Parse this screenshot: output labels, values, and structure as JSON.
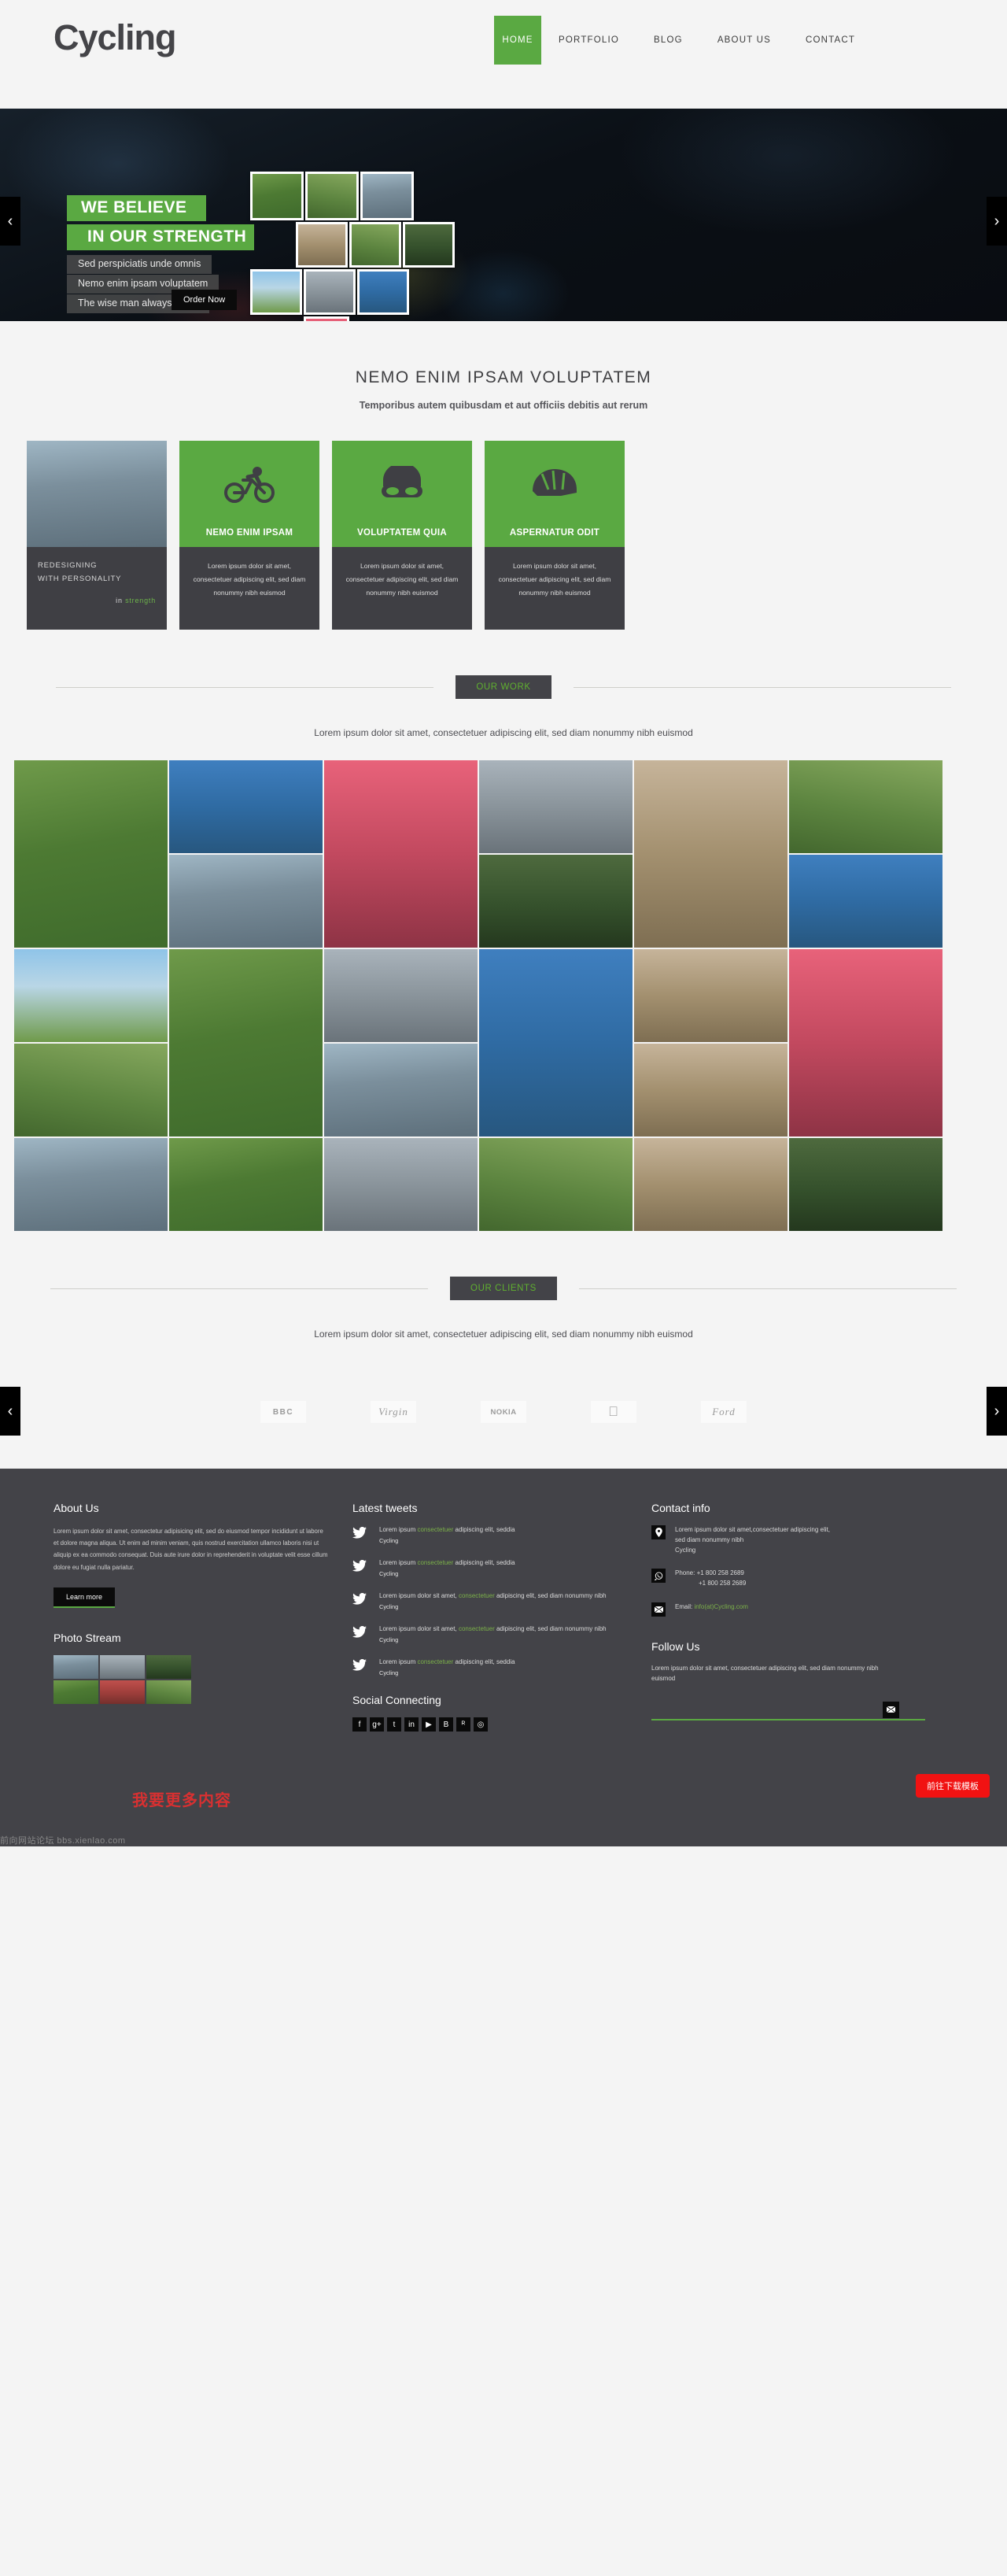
{
  "header": {
    "logo": "Cycling",
    "nav": [
      {
        "label": "HOME",
        "active": true
      },
      {
        "label": "PORTFOLIO",
        "active": false
      },
      {
        "label": "BLOG",
        "active": false
      },
      {
        "label": "ABOUT US",
        "active": false
      },
      {
        "label": "CONTACT",
        "active": false
      }
    ]
  },
  "hero": {
    "headline1": "WE BELIEVE",
    "headline2": "IN OUR STRENGTH",
    "sub1": "Sed perspiciatis unde omnis",
    "sub2": "Nemo enim ipsam voluptatem",
    "sub3": "The wise man always holds",
    "order_button": "Order Now",
    "prev_arrow": "‹",
    "next_arrow": "›",
    "dots": 5,
    "active_dot": 0,
    "accent_color": "#5aa942"
  },
  "intro": {
    "title": "NEMO ENIM IPSAM VOLUPTATEM",
    "subtitle": "Temporibus autem quibusdam et aut officiis debitis aut rerum"
  },
  "features": {
    "photo_card": {
      "line1": "REDESIGNING",
      "line2": "WITH PERSONALITY",
      "tail_plain": "in ",
      "tail_green": "strength"
    },
    "cards": [
      {
        "icon": "cyclist-icon",
        "title": "NEMO ENIM IPSAM",
        "body": "Lorem ipsum dolor sit amet, consectetuer adipiscing elit, sed diam nonummy nibh euismod"
      },
      {
        "icon": "goggles-icon",
        "title": "VOLUPTATEM QUIA",
        "body": "Lorem ipsum dolor sit amet, consectetuer adipiscing elit, sed diam nonummy nibh euismod"
      },
      {
        "icon": "helmet-icon",
        "title": "ASPERNATUR ODIT",
        "body": "Lorem ipsum dolor sit amet, consectetuer adipiscing elit, sed diam nonummy nibh euismod"
      }
    ]
  },
  "work": {
    "badge": "OUR WORK",
    "caption": "Lorem ipsum dolor sit amet, consectetuer adipiscing elit, sed diam nonummy nibh euismod"
  },
  "clients": {
    "badge": "OUR CLIENTS",
    "caption": "Lorem ipsum dolor sit amet, consectetuer adipiscing elit, sed diam nonummy nibh euismod",
    "prev_arrow": "‹",
    "next_arrow": "›",
    "logos": [
      {
        "name": "BBC",
        "label": "BBC"
      },
      {
        "name": "Virgin",
        "label": "Virgin"
      },
      {
        "name": "NOKIA",
        "label": "NOKIA"
      },
      {
        "name": "Apple",
        "label": ""
      },
      {
        "name": "Ford",
        "label": "Ford"
      }
    ]
  },
  "footer": {
    "about": {
      "title": "About Us",
      "text": "Lorem ipsum dolor sit amet, consectetur adipisicing elit, sed do eiusmod tempor incididunt ut labore et dolore magna aliqua. Ut enim ad minim veniam, quis nostrud exercitation ullamco laboris nisi ut aliquip ex ea commodo consequat. Duis aute irure dolor in reprehenderit in voluptate velit esse cillum dolore eu fugiat nulla pariatur.",
      "button": "Learn more"
    },
    "photo_stream": {
      "title": "Photo Stream"
    },
    "tweets": {
      "title": "Latest tweets",
      "items": [
        {
          "pre": "Lorem ipsum ",
          "link": "consectetuer",
          "post": " adipiscing elit, seddia",
          "handle": "Cycling"
        },
        {
          "pre": "Lorem ipsum ",
          "link": "consectetuer",
          "post": " adipiscing elit, seddia",
          "handle": "Cycling"
        },
        {
          "pre": "Lorem ipsum dolor sit amet, ",
          "link": "consectetuer",
          "post": " adipiscing elit, sed diam nonummy nibh",
          "handle": "Cycling"
        },
        {
          "pre": "Lorem ipsum dolor sit amet, ",
          "link": "consectetuer",
          "post": " adipiscing elit, sed diam nonummy nibh",
          "handle": "Cycling"
        },
        {
          "pre": "Lorem ipsum ",
          "link": "consectetuer",
          "post": " adipiscing elit, seddia",
          "handle": "Cycling"
        }
      ]
    },
    "social": {
      "title": "Social Connecting",
      "icons": [
        "facebook-icon",
        "google-plus-icon",
        "twitter-icon",
        "linkedin-icon",
        "youtube-icon",
        "blogger-icon",
        "rss-icon",
        "dribbble-icon"
      ],
      "glyphs": [
        "f",
        "g+",
        "t",
        "in",
        "▶",
        "B",
        "ᴿ",
        "◎"
      ]
    },
    "contact": {
      "title": "Contact info",
      "address_line1": "Lorem ipsum dolor sit amet,consectetuer adipiscing elit,",
      "address_line2": "sed diam nonummy nibh",
      "address_line3": "Cycling",
      "phone_line1": "Phone: +1 800 258 2689",
      "phone_line2": "+1 800 258 2689",
      "email_label": "Email: ",
      "email_value": "info(at)Cycling.com"
    },
    "follow": {
      "title": "Follow Us",
      "text": "Lorem ipsum dolor sit amet, consectetuer adipiscing elit, sed diam nonummy nibh euismod",
      "input_placeholder": ""
    },
    "download_badge": "前往下载模板",
    "watermark_left": "前向网站论坛 bbs.xienlao.com",
    "watermark_red": "我要更多内容"
  }
}
